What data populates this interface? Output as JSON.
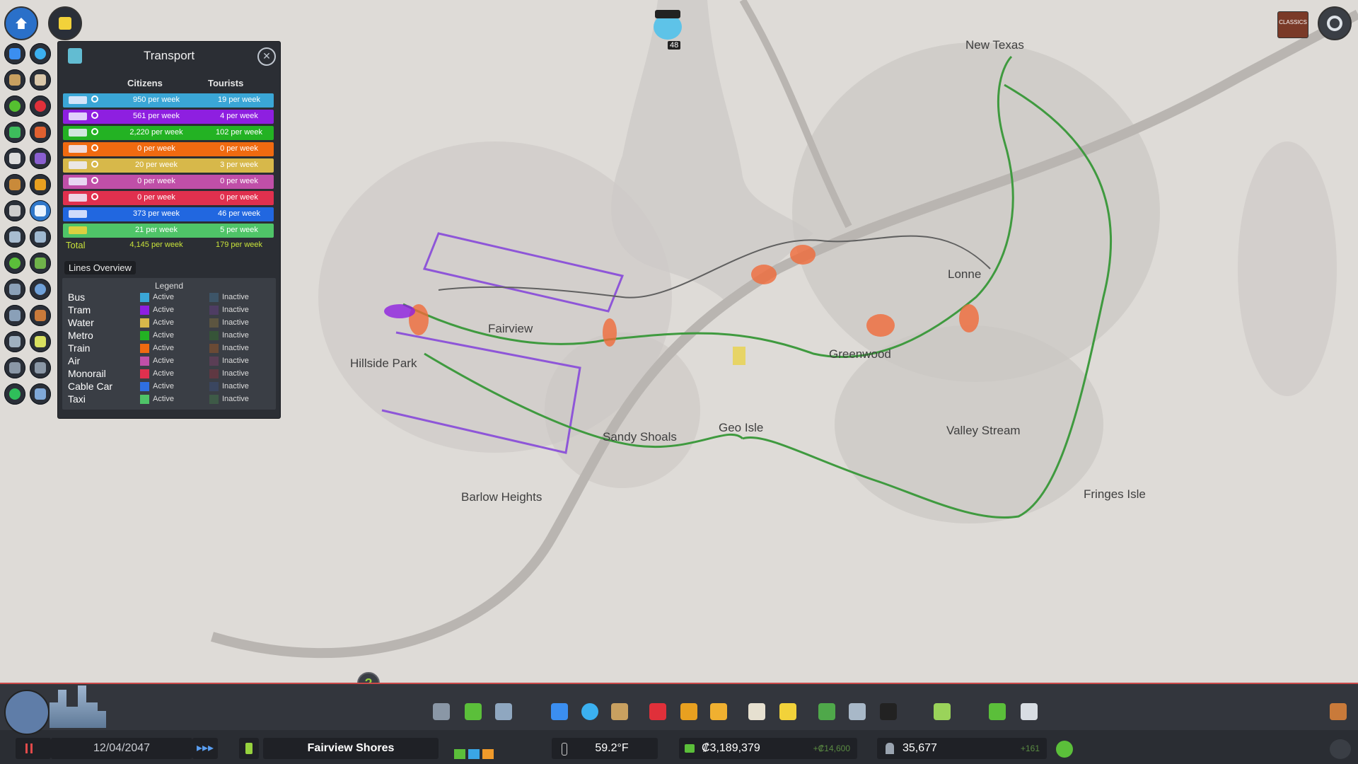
{
  "panel": {
    "title": "Transport",
    "close_label": "✕",
    "col_citizens": "Citizens",
    "col_tourists": "Tourists",
    "rows": [
      {
        "mode": "bus",
        "citizens": "950 per week",
        "tourists": "19 per week",
        "color": "#3aa6d6"
      },
      {
        "mode": "tram",
        "citizens": "561 per week",
        "tourists": "4 per week",
        "color": "#8e1fe0"
      },
      {
        "mode": "metro",
        "citizens": "2,220 per week",
        "tourists": "102 per week",
        "color": "#23b223"
      },
      {
        "mode": "train",
        "citizens": "0 per week",
        "tourists": "0 per week",
        "color": "#f06a10"
      },
      {
        "mode": "ship",
        "citizens": "20 per week",
        "tourists": "3 per week",
        "color": "#d7b84a"
      },
      {
        "mode": "air",
        "citizens": "0 per week",
        "tourists": "0 per week",
        "color": "#c04fa8"
      },
      {
        "mode": "monorail",
        "citizens": "0 per week",
        "tourists": "0 per week",
        "color": "#e0304e"
      },
      {
        "mode": "ferry",
        "citizens": "373 per week",
        "tourists": "46 per week",
        "color": "#2167e0"
      },
      {
        "mode": "taxi",
        "citizens": "21 per week",
        "tourists": "5 per week",
        "color": "#4fc468"
      }
    ],
    "total_label": "Total",
    "total_citizens": "4,145 per week",
    "total_tourists": "179 per week",
    "lines_tab": "Lines Overview",
    "legend_title": "Legend",
    "legend": [
      {
        "name": "Bus",
        "active": "Active",
        "inactive": "Inactive",
        "color": "#3aa6d6",
        "dim": "#3d5568"
      },
      {
        "name": "Tram",
        "active": "Active",
        "inactive": "Inactive",
        "color": "#8e1fe0",
        "dim": "#4e3d63"
      },
      {
        "name": "Water",
        "active": "Active",
        "inactive": "Inactive",
        "color": "#d7b84a",
        "dim": "#5c5540"
      },
      {
        "name": "Metro",
        "active": "Active",
        "inactive": "Inactive",
        "color": "#23b223",
        "dim": "#365438"
      },
      {
        "name": "Train",
        "active": "Active",
        "inactive": "Inactive",
        "color": "#f06a10",
        "dim": "#6a4a35"
      },
      {
        "name": "Air",
        "active": "Active",
        "inactive": "Inactive",
        "color": "#c04fa8",
        "dim": "#5a3e55"
      },
      {
        "name": "Monorail",
        "active": "Active",
        "inactive": "Inactive",
        "color": "#e0304e",
        "dim": "#5f3842"
      },
      {
        "name": "Cable Car",
        "active": "Active",
        "inactive": "Inactive",
        "color": "#2f6fe0",
        "dim": "#3a4660"
      },
      {
        "name": "Taxi",
        "active": "Active",
        "inactive": "Inactive",
        "color": "#4fc468",
        "dim": "#3e5a47"
      }
    ]
  },
  "map": {
    "cities": [
      "New Texas",
      "Lonne",
      "Fairview",
      "Hillside Park",
      "Greenwood",
      "Geo Isle",
      "Sandy Shoals",
      "Valley Stream",
      "Fringes Isle",
      "Barlow Heights"
    ],
    "mascot_count": "48"
  },
  "bottom": {
    "date": "12/04/2047",
    "city_name": "Fairview Shores",
    "temperature": "59.2°F",
    "money": "₡3,189,379",
    "income": "+₡14,600",
    "population": "35,677",
    "pop_change": "+161",
    "help_label": "?"
  },
  "top_right": {
    "badge_label": "CLASSICS"
  }
}
